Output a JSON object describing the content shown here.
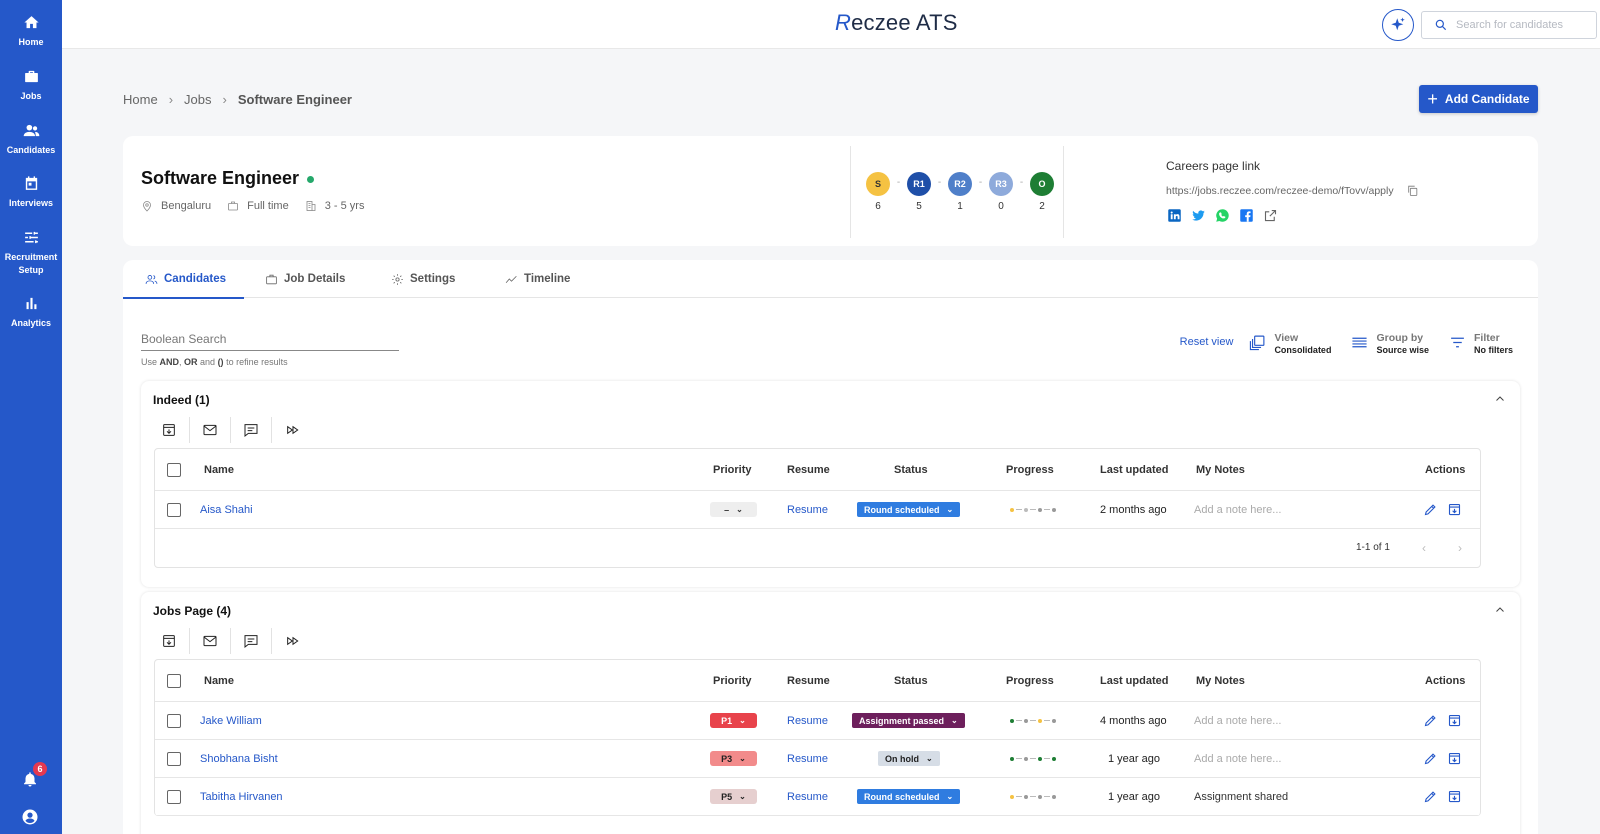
{
  "app": {
    "logo_mark": "R",
    "logo_rest": "eczee",
    "logo_suffix": "ATS"
  },
  "sidebar": {
    "items": [
      {
        "label": "Home",
        "icon": "home-icon"
      },
      {
        "label": "Jobs",
        "icon": "briefcase-icon"
      },
      {
        "label": "Candidates",
        "icon": "people-icon"
      },
      {
        "label": "Interviews",
        "icon": "calendar-icon"
      },
      {
        "label": "Recruitment Setup",
        "icon": "sliders-icon"
      },
      {
        "label": "Analytics",
        "icon": "bar-chart-icon"
      }
    ],
    "notification_count": "6"
  },
  "header": {
    "search_placeholder": "Search for candidates"
  },
  "breadcrumb": {
    "items": [
      "Home",
      "Jobs",
      "Software Engineer"
    ]
  },
  "add_candidate_label": "Add Candidate",
  "job": {
    "title": "Software Engineer",
    "location": "Bengaluru",
    "type": "Full time",
    "experience": "3 - 5 yrs",
    "stages": [
      {
        "code": "S",
        "count": "6",
        "color": "#f5c242"
      },
      {
        "code": "R1",
        "count": "5",
        "color": "#1f4fa8"
      },
      {
        "code": "R2",
        "count": "1",
        "color": "#4f7fc9"
      },
      {
        "code": "R3",
        "count": "0",
        "color": "#8eaadb"
      },
      {
        "code": "O",
        "count": "2",
        "color": "#1e7e34"
      }
    ],
    "careers_label": "Careers page link",
    "careers_url": "https://jobs.reczee.com/reczee-demo/fTovv/apply"
  },
  "tabs": [
    {
      "label": "Candidates",
      "active": true
    },
    {
      "label": "Job Details",
      "active": false
    },
    {
      "label": "Settings",
      "active": false
    },
    {
      "label": "Timeline",
      "active": false
    }
  ],
  "boolean_search": {
    "placeholder": "Boolean Search",
    "hint_pre": "Use ",
    "hint_and": "AND",
    "hint_comma": ", ",
    "hint_or": "OR",
    "hint_mid": " and ",
    "hint_paren": "()",
    "hint_post": " to refine results"
  },
  "view_controls": {
    "reset": "Reset view",
    "view_title": "View",
    "view_value": "Consolidated",
    "group_title": "Group by",
    "group_value": "Source wise",
    "filter_title": "Filter",
    "filter_value": "No filters"
  },
  "columns": [
    "Name",
    "Priority",
    "Resume",
    "Status",
    "Progress",
    "Last updated",
    "My Notes",
    "Actions"
  ],
  "groups": [
    {
      "title": "Indeed (1)",
      "pagination": "1-1 of 1",
      "rows": [
        {
          "name": "Aisa Shahi",
          "priority": "–",
          "priority_bg": "#eeeeee",
          "priority_fg": "#333333",
          "resume": "Resume",
          "status": "Round scheduled",
          "status_bg": "#2f7ce0",
          "progress": [
            "#f5c242",
            "#bbbbbb",
            "#999999",
            "#999999"
          ],
          "updated": "2 months ago",
          "note": "Add a note here...",
          "note_filled": false
        }
      ]
    },
    {
      "title": "Jobs Page (4)",
      "rows": [
        {
          "name": "Jake William",
          "priority": "P1",
          "priority_bg": "#e8434b",
          "priority_fg": "#ffffff",
          "resume": "Resume",
          "status": "Assignment passed",
          "status_bg": "#6d1f5c",
          "progress": [
            "#1e7e34",
            "#999999",
            "#f5c242",
            "#999999"
          ],
          "updated": "4 months ago",
          "note": "Add a note here...",
          "note_filled": false
        },
        {
          "name": "Shobhana Bisht",
          "priority": "P3",
          "priority_bg": "#f28b8b",
          "priority_fg": "#222222",
          "resume": "Resume",
          "status": "On hold",
          "status_bg": "#d6dde6",
          "status_fg": "#222222",
          "progress": [
            "#1e7e34",
            "#999999",
            "#1e7e34",
            "#1e7e34"
          ],
          "updated": "1 year ago",
          "note": "Add a note here...",
          "note_filled": false
        },
        {
          "name": "Tabitha Hirvanen",
          "priority": "P5",
          "priority_bg": "#e6cfcf",
          "priority_fg": "#222222",
          "resume": "Resume",
          "status": "Round scheduled",
          "status_bg": "#2f7ce0",
          "progress": [
            "#f5c242",
            "#999999",
            "#999999",
            "#999999"
          ],
          "updated": "1 year ago",
          "note": "Assignment shared",
          "note_filled": true
        }
      ]
    }
  ]
}
